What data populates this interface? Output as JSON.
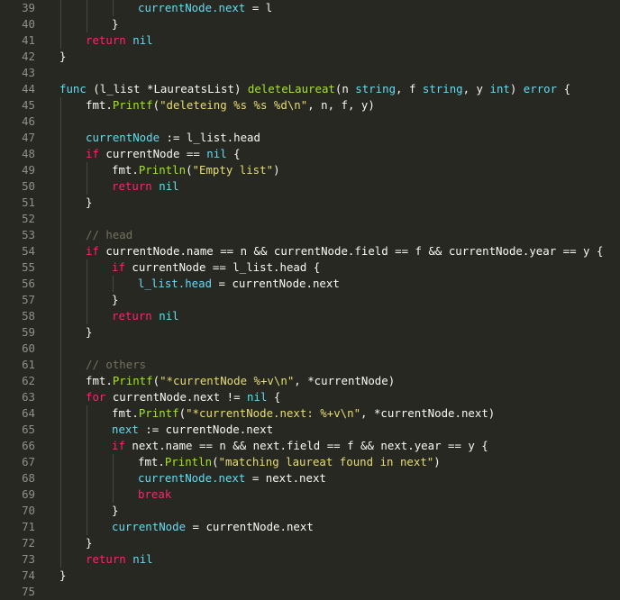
{
  "editor": {
    "theme_colors": {
      "background": "#272822",
      "foreground": "#f8f8f2",
      "keyword": "#f92672",
      "function": "#a6e22e",
      "string": "#e6db74",
      "type": "#66d9ef",
      "comment": "#75715e",
      "line_number": "#90908a"
    },
    "lines": [
      {
        "n": "39",
        "indent": 3,
        "tokens": [
          [
            "var",
            "currentNode.next"
          ],
          [
            "plain",
            " = l"
          ]
        ]
      },
      {
        "n": "40",
        "indent": 2,
        "tokens": [
          [
            "plain",
            "}"
          ]
        ]
      },
      {
        "n": "41",
        "indent": 1,
        "tokens": [
          [
            "kw",
            "return"
          ],
          [
            "plain",
            " "
          ],
          [
            "type",
            "nil"
          ]
        ]
      },
      {
        "n": "42",
        "indent": 0,
        "tokens": [
          [
            "plain",
            "}"
          ]
        ]
      },
      {
        "n": "43",
        "indent": 0,
        "tokens": []
      },
      {
        "n": "44",
        "indent": 0,
        "tokens": [
          [
            "type",
            "func"
          ],
          [
            "plain",
            " (l_list *LaureatsList) "
          ],
          [
            "fn",
            "deleteLaureat"
          ],
          [
            "plain",
            "(n "
          ],
          [
            "type",
            "string"
          ],
          [
            "plain",
            ", f "
          ],
          [
            "type",
            "string"
          ],
          [
            "plain",
            ", y "
          ],
          [
            "type",
            "int"
          ],
          [
            "plain",
            ") "
          ],
          [
            "type",
            "error"
          ],
          [
            "plain",
            " {"
          ]
        ]
      },
      {
        "n": "45",
        "indent": 1,
        "tokens": [
          [
            "plain",
            "fmt."
          ],
          [
            "fn",
            "Printf"
          ],
          [
            "plain",
            "("
          ],
          [
            "str",
            "\"deleteing %s %s %d\\n\""
          ],
          [
            "plain",
            ", n, f, y)"
          ]
        ]
      },
      {
        "n": "46",
        "indent": 1,
        "tokens": []
      },
      {
        "n": "47",
        "indent": 1,
        "tokens": [
          [
            "var",
            "currentNode"
          ],
          [
            "plain",
            " := l_list.head"
          ]
        ]
      },
      {
        "n": "48",
        "indent": 1,
        "tokens": [
          [
            "kw",
            "if"
          ],
          [
            "plain",
            " currentNode == "
          ],
          [
            "type",
            "nil"
          ],
          [
            "plain",
            " {"
          ]
        ]
      },
      {
        "n": "49",
        "indent": 2,
        "tokens": [
          [
            "plain",
            "fmt."
          ],
          [
            "fn",
            "Println"
          ],
          [
            "plain",
            "("
          ],
          [
            "str",
            "\"Empty list\""
          ],
          [
            "plain",
            ")"
          ]
        ]
      },
      {
        "n": "50",
        "indent": 2,
        "tokens": [
          [
            "kw",
            "return"
          ],
          [
            "plain",
            " "
          ],
          [
            "type",
            "nil"
          ]
        ]
      },
      {
        "n": "51",
        "indent": 1,
        "tokens": [
          [
            "plain",
            "}"
          ]
        ]
      },
      {
        "n": "52",
        "indent": 1,
        "tokens": []
      },
      {
        "n": "53",
        "indent": 1,
        "tokens": [
          [
            "comment",
            "// head"
          ]
        ]
      },
      {
        "n": "54",
        "indent": 1,
        "tokens": [
          [
            "kw",
            "if"
          ],
          [
            "plain",
            " currentNode.name == n && currentNode.field == f && currentNode.year == y {"
          ]
        ]
      },
      {
        "n": "55",
        "indent": 2,
        "tokens": [
          [
            "kw",
            "if"
          ],
          [
            "plain",
            " currentNode == l_list.head {"
          ]
        ]
      },
      {
        "n": "56",
        "indent": 3,
        "tokens": [
          [
            "var",
            "l_list.head"
          ],
          [
            "plain",
            " = currentNode.next"
          ]
        ]
      },
      {
        "n": "57",
        "indent": 2,
        "tokens": [
          [
            "plain",
            "}"
          ]
        ]
      },
      {
        "n": "58",
        "indent": 2,
        "tokens": [
          [
            "kw",
            "return"
          ],
          [
            "plain",
            " "
          ],
          [
            "type",
            "nil"
          ]
        ]
      },
      {
        "n": "59",
        "indent": 1,
        "tokens": [
          [
            "plain",
            "}"
          ]
        ]
      },
      {
        "n": "60",
        "indent": 1,
        "tokens": []
      },
      {
        "n": "61",
        "indent": 1,
        "tokens": [
          [
            "comment",
            "// others"
          ]
        ]
      },
      {
        "n": "62",
        "indent": 1,
        "tokens": [
          [
            "plain",
            "fmt."
          ],
          [
            "fn",
            "Printf"
          ],
          [
            "plain",
            "("
          ],
          [
            "str",
            "\"*currentNode %+v\\n\""
          ],
          [
            "plain",
            ", *currentNode)"
          ]
        ]
      },
      {
        "n": "63",
        "indent": 1,
        "tokens": [
          [
            "kw",
            "for"
          ],
          [
            "plain",
            " currentNode.next != "
          ],
          [
            "type",
            "nil"
          ],
          [
            "plain",
            " {"
          ]
        ]
      },
      {
        "n": "64",
        "indent": 2,
        "tokens": [
          [
            "plain",
            "fmt."
          ],
          [
            "fn",
            "Printf"
          ],
          [
            "plain",
            "("
          ],
          [
            "str",
            "\"*currentNode.next: %+v\\n\""
          ],
          [
            "plain",
            ", *currentNode.next)"
          ]
        ]
      },
      {
        "n": "65",
        "indent": 2,
        "tokens": [
          [
            "var",
            "next"
          ],
          [
            "plain",
            " := currentNode.next"
          ]
        ]
      },
      {
        "n": "66",
        "indent": 2,
        "tokens": [
          [
            "kw",
            "if"
          ],
          [
            "plain",
            " next.name == n && next.field == f && next.year == y {"
          ]
        ]
      },
      {
        "n": "67",
        "indent": 3,
        "tokens": [
          [
            "plain",
            "fmt."
          ],
          [
            "fn",
            "Println"
          ],
          [
            "plain",
            "("
          ],
          [
            "str",
            "\"matching laureat found in next\""
          ],
          [
            "plain",
            ")"
          ]
        ]
      },
      {
        "n": "68",
        "indent": 3,
        "tokens": [
          [
            "var",
            "currentNode.next"
          ],
          [
            "plain",
            " = next.next"
          ]
        ]
      },
      {
        "n": "69",
        "indent": 3,
        "tokens": [
          [
            "kw",
            "break"
          ]
        ]
      },
      {
        "n": "70",
        "indent": 2,
        "tokens": [
          [
            "plain",
            "}"
          ]
        ]
      },
      {
        "n": "71",
        "indent": 2,
        "tokens": [
          [
            "var",
            "currentNode"
          ],
          [
            "plain",
            " = currentNode.next"
          ]
        ]
      },
      {
        "n": "72",
        "indent": 1,
        "tokens": [
          [
            "plain",
            "}"
          ]
        ]
      },
      {
        "n": "73",
        "indent": 1,
        "tokens": [
          [
            "kw",
            "return"
          ],
          [
            "plain",
            " "
          ],
          [
            "type",
            "nil"
          ]
        ]
      },
      {
        "n": "74",
        "indent": 0,
        "tokens": [
          [
            "plain",
            "}"
          ]
        ]
      },
      {
        "n": "75",
        "indent": 0,
        "tokens": []
      }
    ]
  }
}
